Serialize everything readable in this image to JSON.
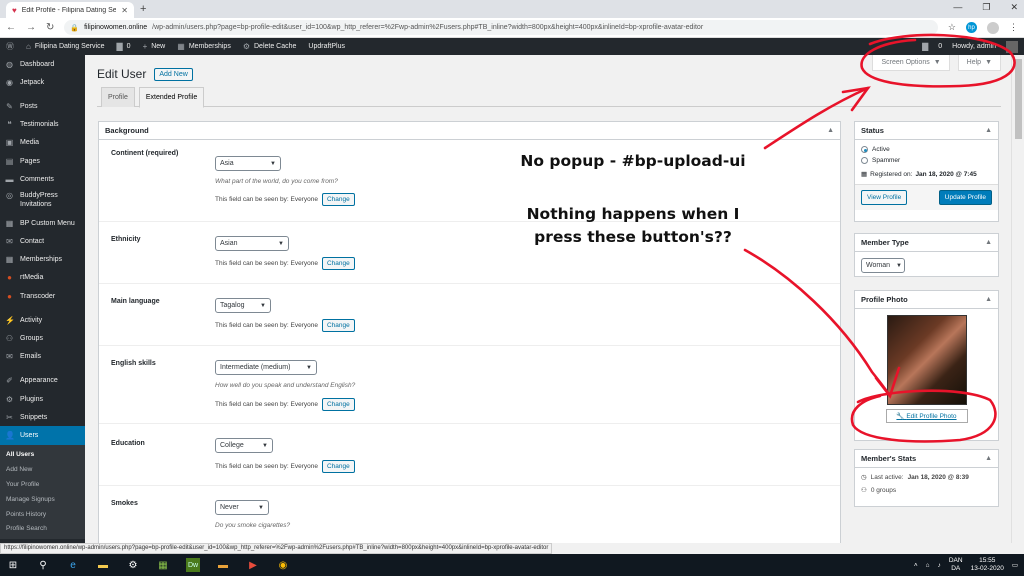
{
  "browser": {
    "tab_title": "Edit Profile - Filipina Dating Servi",
    "url_host": "filipinowomen.online",
    "url_path": "/wp-admin/users.php?page=bp-profile-edit&user_id=100&wp_http_referer=%2Fwp-admin%2Fusers.php#TB_inline?width=800px&height=400px&inlineId=bp-xprofile-avatar-editor"
  },
  "adminbar": {
    "site_name": "Filipina Dating Service",
    "comments_count": "0",
    "new_label": "New",
    "memberships_label": "Memberships",
    "delete_cache_label": "Delete Cache",
    "updraft_label": "UpdraftPlus",
    "notif_count": "0",
    "howdy": "Howdy, admin"
  },
  "sidebar": {
    "items": [
      {
        "label": "Dashboard",
        "icon": "dashboard-icon"
      },
      {
        "label": "Jetpack",
        "icon": "jetpack-icon"
      },
      {
        "label": "Posts",
        "icon": "pin-icon"
      },
      {
        "label": "Testimonials",
        "icon": "quote-icon"
      },
      {
        "label": "Media",
        "icon": "media-icon"
      },
      {
        "label": "Pages",
        "icon": "page-icon"
      },
      {
        "label": "Comments",
        "icon": "comment-icon"
      },
      {
        "label": "BuddyPress Invitations",
        "icon": "buddypress-icon"
      },
      {
        "label": "BP Custom Menu",
        "icon": "menu-icon"
      },
      {
        "label": "Contact",
        "icon": "mail-icon"
      },
      {
        "label": "Memberships",
        "icon": "memberships-icon"
      },
      {
        "label": "rtMedia",
        "icon": "rtmedia-icon"
      },
      {
        "label": "Transcoder",
        "icon": "transcoder-icon"
      },
      {
        "label": "Activity",
        "icon": "activity-icon"
      },
      {
        "label": "Groups",
        "icon": "groups-icon"
      },
      {
        "label": "Emails",
        "icon": "email-icon"
      },
      {
        "label": "Appearance",
        "icon": "brush-icon"
      },
      {
        "label": "Plugins",
        "icon": "plugin-icon"
      },
      {
        "label": "Snippets",
        "icon": "scissors-icon"
      },
      {
        "label": "Users",
        "icon": "users-icon"
      }
    ],
    "submenu": [
      "All Users",
      "Add New",
      "Your Profile",
      "Manage Signups",
      "Points History",
      "Profile Search"
    ]
  },
  "screen_options": "Screen Options",
  "help": "Help",
  "page_title": "Edit User",
  "add_new": "Add New",
  "tabs": [
    "Profile",
    "Extended Profile"
  ],
  "background_title": "Background",
  "visibility_text": "This field can be seen by: Everyone",
  "change_label": "Change",
  "fields": [
    {
      "label": "Continent (required)",
      "value": "Asia",
      "desc": "What part of the world, do you come from?"
    },
    {
      "label": "Ethnicity",
      "value": "Asian",
      "desc": ""
    },
    {
      "label": "Main language",
      "value": "Tagalog",
      "desc": ""
    },
    {
      "label": "English skills",
      "value": "Intermediate (medium)",
      "desc": "How well do you speak and understand English?"
    },
    {
      "label": "Education",
      "value": "College",
      "desc": ""
    },
    {
      "label": "Smokes",
      "value": "Never",
      "desc": "Do you smoke cigarettes?"
    }
  ],
  "status_box": {
    "title": "Status",
    "active": "Active",
    "spammer": "Spammer",
    "registered_label": "Registered on:",
    "registered_date": "Jan 18, 2020 @ 7:45",
    "view_profile": "View Profile",
    "update_profile": "Update Profile"
  },
  "member_type": {
    "title": "Member Type",
    "value": "Woman"
  },
  "profile_photo": {
    "title": "Profile Photo",
    "edit_link": "Edit Profile Photo"
  },
  "member_stats": {
    "title": "Member's Stats",
    "last_active_label": "Last active:",
    "last_active": "Jan 18, 2020 @ 8:39",
    "groups": "0 groups"
  },
  "annotations": {
    "line1": "No popup - #bp-upload-ui",
    "line2": "Nothing happens when I",
    "line3": "press these button's??"
  },
  "status_url": "https://filipinowomen.online/wp-admin/users.php?page=bp-profile-edit&user_id=100&wp_http_referer=%2Fwp-admin%2Fusers.php#TB_inline?width=800px&height=400px&inlineId=bp-xprofile-avatar-editor",
  "taskbar": {
    "lang1": "DAN",
    "lang2": "DA",
    "time": "15:55",
    "date": "13-02-2020"
  },
  "colors": {
    "accent": "#0073aa",
    "adminbar": "#23282d",
    "annotation": "#e8132a"
  }
}
